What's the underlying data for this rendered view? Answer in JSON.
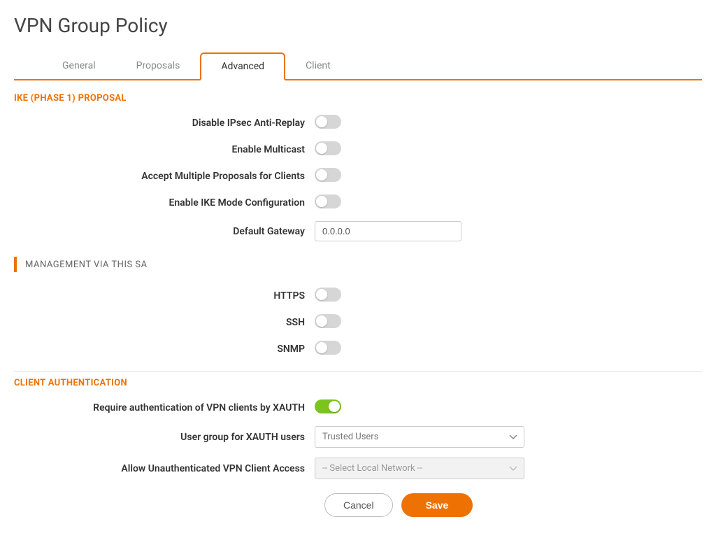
{
  "page": {
    "title": "VPN Group Policy"
  },
  "tabs": {
    "general": "General",
    "proposals": "Proposals",
    "advanced": "Advanced",
    "client": "Client",
    "active": "advanced"
  },
  "sections": {
    "ike": {
      "heading": "IKE (PHASE 1) PROPOSAL",
      "disable_anti_replay_label": "Disable IPsec Anti-Replay",
      "disable_anti_replay_on": false,
      "enable_multicast_label": "Enable Multicast",
      "enable_multicast_on": false,
      "accept_multiple_label": "Accept Multiple Proposals for Clients",
      "accept_multiple_on": false,
      "enable_ike_mode_label": "Enable IKE Mode Configuration",
      "enable_ike_mode_on": false,
      "default_gateway_label": "Default Gateway",
      "default_gateway_value": "0.0.0.0"
    },
    "management": {
      "heading": "MANAGEMENT VIA THIS SA",
      "https_label": "HTTPS",
      "https_on": false,
      "ssh_label": "SSH",
      "ssh_on": false,
      "snmp_label": "SNMP",
      "snmp_on": false
    },
    "client_auth": {
      "heading": "CLIENT AUTHENTICATION",
      "require_xauth_label": "Require authentication of VPN clients by XAUTH",
      "require_xauth_on": true,
      "user_group_label": "User group for XAUTH users",
      "user_group_value": "Trusted Users",
      "allow_unauth_label": "Allow Unauthenticated VPN Client Access",
      "allow_unauth_value": "-- Select Local Network --"
    }
  },
  "buttons": {
    "cancel": "Cancel",
    "save": "Save"
  },
  "colors": {
    "accent": "#ee7203",
    "toggle_on": "#7bc41d"
  }
}
